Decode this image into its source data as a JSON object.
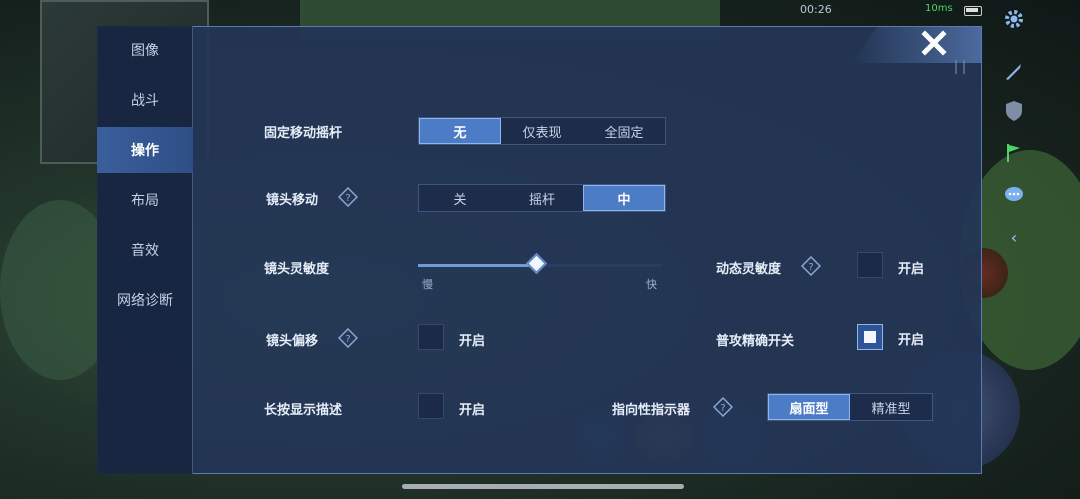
{
  "status": {
    "time": "00:26",
    "ping": "10ms"
  },
  "sidebar": {
    "items": [
      {
        "label": "图像"
      },
      {
        "label": "战斗"
      },
      {
        "label": "操作",
        "active": true
      },
      {
        "label": "布局"
      },
      {
        "label": "音效"
      },
      {
        "label": "网络诊断"
      }
    ]
  },
  "settings": {
    "fixed_joystick": {
      "label": "固定移动摇杆",
      "options": [
        "无",
        "仅表现",
        "全固定"
      ],
      "selected": "无"
    },
    "camera_move": {
      "label": "镜头移动",
      "options": [
        "关",
        "摇杆",
        "中"
      ],
      "selected": "中"
    },
    "camera_sensitivity": {
      "label": "镜头灵敏度",
      "min_label": "慢",
      "max_label": "快",
      "value": 0.49
    },
    "dynamic_sensitivity": {
      "label": "动态灵敏度",
      "toggle_label": "开启",
      "checked": false
    },
    "camera_offset": {
      "label": "镜头偏移",
      "toggle_label": "开启",
      "checked": false
    },
    "precise_attack": {
      "label": "普攻精确开关",
      "toggle_label": "开启",
      "checked": true
    },
    "long_press_desc": {
      "label": "长按显示描述",
      "toggle_label": "开启",
      "checked": false
    },
    "direction_indicator": {
      "label": "指向性指示器",
      "options": [
        "扇面型",
        "精准型"
      ],
      "selected": "扇面型"
    }
  },
  "colors": {
    "panel": "#243656",
    "accent": "#4d7cc6",
    "ping": "#4ed36a"
  }
}
